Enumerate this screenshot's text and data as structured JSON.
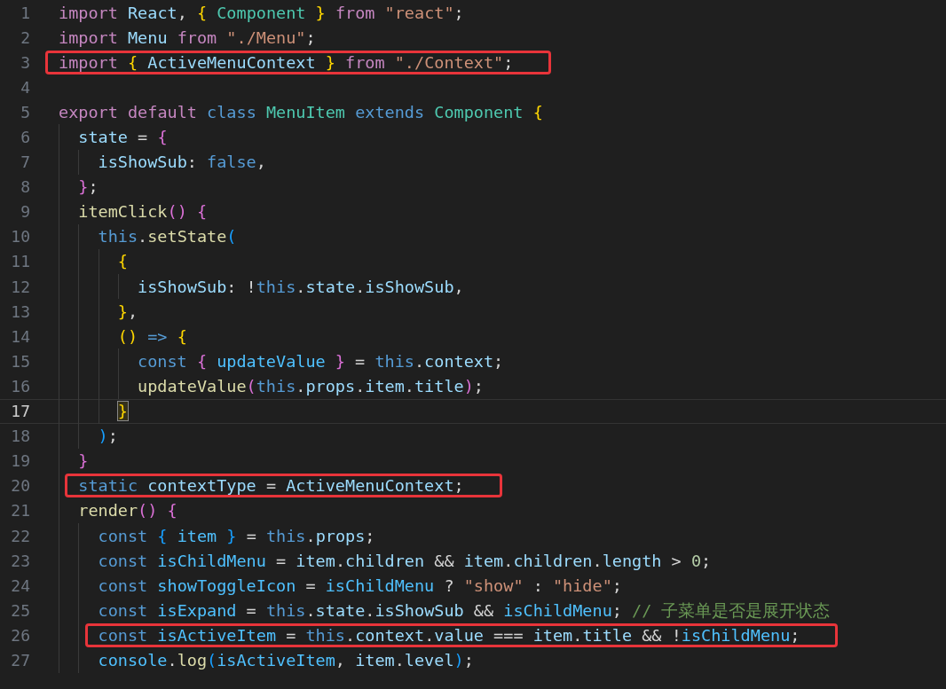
{
  "editor": {
    "lines": [
      {
        "number": "1",
        "current": false,
        "boxed": false,
        "tokens": [
          {
            "kind": "kw",
            "text": "import"
          },
          {
            "kind": "var",
            "text": " React"
          },
          {
            "kind": "p",
            "text": ", "
          },
          {
            "kind": "b1",
            "text": "{"
          },
          {
            "kind": "cls",
            "text": " Component"
          },
          {
            "kind": "b1",
            "text": " }"
          },
          {
            "kind": "kw",
            "text": " from"
          },
          {
            "kind": "str",
            "text": " \"react\""
          },
          {
            "kind": "p",
            "text": ";"
          }
        ]
      },
      {
        "number": "2",
        "current": false,
        "boxed": false,
        "tokens": [
          {
            "kind": "kw",
            "text": "import"
          },
          {
            "kind": "var",
            "text": " Menu"
          },
          {
            "kind": "kw",
            "text": " from"
          },
          {
            "kind": "str",
            "text": " \"./Menu\""
          },
          {
            "kind": "p",
            "text": ";"
          }
        ]
      },
      {
        "number": "3",
        "current": false,
        "boxed": true,
        "tokens": [
          {
            "kind": "kw",
            "text": "import"
          },
          {
            "kind": "b1",
            "text": " {"
          },
          {
            "kind": "var",
            "text": " ActiveMenuContext"
          },
          {
            "kind": "b1",
            "text": " }"
          },
          {
            "kind": "kw",
            "text": " from"
          },
          {
            "kind": "str",
            "text": " \"./Context\""
          },
          {
            "kind": "p",
            "text": ";"
          }
        ]
      },
      {
        "number": "4",
        "current": false
      },
      {
        "number": "5",
        "current": false,
        "boxed": false,
        "tokens": [
          {
            "kind": "kw",
            "text": "export"
          },
          {
            "kind": "kw",
            "text": " default"
          },
          {
            "kind": "decl",
            "text": " class"
          },
          {
            "kind": "cls",
            "text": " MenuItem"
          },
          {
            "kind": "decl",
            "text": " extends"
          },
          {
            "kind": "cls",
            "text": " Component"
          },
          {
            "kind": "b1",
            "text": " {"
          }
        ]
      },
      {
        "number": "6",
        "current": false,
        "boxed": false,
        "tokens": [
          {
            "kind": "var",
            "text": "  state"
          },
          {
            "kind": "p",
            "text": " = "
          },
          {
            "kind": "b2",
            "text": "{"
          }
        ]
      },
      {
        "number": "7",
        "current": false,
        "boxed": false,
        "tokens": [
          {
            "kind": "var",
            "text": "    isShowSub"
          },
          {
            "kind": "p",
            "text": ": "
          },
          {
            "kind": "decl",
            "text": "false"
          },
          {
            "kind": "p",
            "text": ","
          }
        ]
      },
      {
        "number": "8",
        "current": false,
        "boxed": false,
        "tokens": [
          {
            "kind": "b2",
            "text": "  }"
          },
          {
            "kind": "p",
            "text": ";"
          }
        ]
      },
      {
        "number": "9",
        "current": false,
        "boxed": false,
        "tokens": [
          {
            "kind": "fn",
            "text": "  itemClick"
          },
          {
            "kind": "b2",
            "text": "()"
          },
          {
            "kind": "b2",
            "text": " {"
          }
        ]
      },
      {
        "number": "10",
        "current": false,
        "boxed": false,
        "tokens": [
          {
            "kind": "decl",
            "text": "    this"
          },
          {
            "kind": "p",
            "text": "."
          },
          {
            "kind": "fn",
            "text": "setState"
          },
          {
            "kind": "b3",
            "text": "("
          }
        ]
      },
      {
        "number": "11",
        "current": false,
        "boxed": false,
        "tokens": [
          {
            "kind": "b1",
            "text": "      {"
          }
        ]
      },
      {
        "number": "12",
        "current": false,
        "boxed": false,
        "tokens": [
          {
            "kind": "var",
            "text": "        isShowSub"
          },
          {
            "kind": "p",
            "text": ": !"
          },
          {
            "kind": "decl",
            "text": "this"
          },
          {
            "kind": "p",
            "text": "."
          },
          {
            "kind": "var",
            "text": "state"
          },
          {
            "kind": "p",
            "text": "."
          },
          {
            "kind": "var",
            "text": "isShowSub"
          },
          {
            "kind": "p",
            "text": ","
          }
        ]
      },
      {
        "number": "13",
        "current": false,
        "boxed": false,
        "tokens": [
          {
            "kind": "b1",
            "text": "      }"
          },
          {
            "kind": "p",
            "text": ","
          }
        ]
      },
      {
        "number": "14",
        "current": false,
        "boxed": false,
        "tokens": [
          {
            "kind": "b1",
            "text": "      ()"
          },
          {
            "kind": "decl",
            "text": " =>"
          },
          {
            "kind": "b1",
            "text": " {"
          }
        ]
      },
      {
        "number": "15",
        "current": false,
        "boxed": false,
        "tokens": [
          {
            "kind": "decl",
            "text": "        const"
          },
          {
            "kind": "b2",
            "text": " {"
          },
          {
            "kind": "cst",
            "text": " updateValue"
          },
          {
            "kind": "b2",
            "text": " }"
          },
          {
            "kind": "p",
            "text": " = "
          },
          {
            "kind": "decl",
            "text": "this"
          },
          {
            "kind": "p",
            "text": "."
          },
          {
            "kind": "var",
            "text": "context"
          },
          {
            "kind": "p",
            "text": ";"
          }
        ]
      },
      {
        "number": "16",
        "current": false,
        "boxed": false,
        "tokens": [
          {
            "kind": "fn",
            "text": "        updateValue"
          },
          {
            "kind": "b2",
            "text": "("
          },
          {
            "kind": "decl",
            "text": "this"
          },
          {
            "kind": "p",
            "text": "."
          },
          {
            "kind": "var",
            "text": "props"
          },
          {
            "kind": "p",
            "text": "."
          },
          {
            "kind": "var",
            "text": "item"
          },
          {
            "kind": "p",
            "text": "."
          },
          {
            "kind": "var",
            "text": "title"
          },
          {
            "kind": "b2",
            "text": ")"
          },
          {
            "kind": "p",
            "text": ";"
          }
        ]
      },
      {
        "number": "17",
        "current": true,
        "boxed": false,
        "tokens": [
          {
            "kind": "b1match",
            "text": "      }"
          }
        ]
      },
      {
        "number": "18",
        "current": false,
        "boxed": false,
        "tokens": [
          {
            "kind": "b3",
            "text": "    )"
          },
          {
            "kind": "p",
            "text": ";"
          }
        ]
      },
      {
        "number": "19",
        "current": false,
        "boxed": false,
        "tokens": [
          {
            "kind": "b2",
            "text": "  }"
          }
        ]
      },
      {
        "number": "20",
        "current": false,
        "boxed": true,
        "tokens": [
          {
            "kind": "decl",
            "text": "  static"
          },
          {
            "kind": "var",
            "text": " contextType"
          },
          {
            "kind": "p",
            "text": " = "
          },
          {
            "kind": "var",
            "text": "ActiveMenuContext"
          },
          {
            "kind": "p",
            "text": ";"
          }
        ]
      },
      {
        "number": "21",
        "current": false,
        "boxed": false,
        "tokens": [
          {
            "kind": "fn",
            "text": "  render"
          },
          {
            "kind": "b2",
            "text": "()"
          },
          {
            "kind": "b2",
            "text": " {"
          }
        ]
      },
      {
        "number": "22",
        "current": false,
        "boxed": false,
        "tokens": [
          {
            "kind": "decl",
            "text": "    const"
          },
          {
            "kind": "b3",
            "text": " {"
          },
          {
            "kind": "cst",
            "text": " item"
          },
          {
            "kind": "b3",
            "text": " }"
          },
          {
            "kind": "p",
            "text": " = "
          },
          {
            "kind": "decl",
            "text": "this"
          },
          {
            "kind": "p",
            "text": "."
          },
          {
            "kind": "var",
            "text": "props"
          },
          {
            "kind": "p",
            "text": ";"
          }
        ]
      },
      {
        "number": "23",
        "current": false,
        "boxed": false,
        "tokens": [
          {
            "kind": "decl",
            "text": "    const"
          },
          {
            "kind": "cst",
            "text": " isChildMenu"
          },
          {
            "kind": "p",
            "text": " = "
          },
          {
            "kind": "var",
            "text": "item"
          },
          {
            "kind": "p",
            "text": "."
          },
          {
            "kind": "var",
            "text": "children"
          },
          {
            "kind": "p",
            "text": " && "
          },
          {
            "kind": "var",
            "text": "item"
          },
          {
            "kind": "p",
            "text": "."
          },
          {
            "kind": "var",
            "text": "children"
          },
          {
            "kind": "p",
            "text": "."
          },
          {
            "kind": "var",
            "text": "length"
          },
          {
            "kind": "p",
            "text": " > "
          },
          {
            "kind": "num",
            "text": "0"
          },
          {
            "kind": "p",
            "text": ";"
          }
        ]
      },
      {
        "number": "24",
        "current": false,
        "boxed": false,
        "tokens": [
          {
            "kind": "decl",
            "text": "    const"
          },
          {
            "kind": "cst",
            "text": " showToggleIcon"
          },
          {
            "kind": "p",
            "text": " = "
          },
          {
            "kind": "cst",
            "text": "isChildMenu"
          },
          {
            "kind": "p",
            "text": " ? "
          },
          {
            "kind": "str",
            "text": "\"show\""
          },
          {
            "kind": "p",
            "text": " : "
          },
          {
            "kind": "str",
            "text": "\"hide\""
          },
          {
            "kind": "p",
            "text": ";"
          }
        ]
      },
      {
        "number": "25",
        "current": false,
        "boxed": false,
        "tokens": [
          {
            "kind": "decl",
            "text": "    const"
          },
          {
            "kind": "cst",
            "text": " isExpand"
          },
          {
            "kind": "p",
            "text": " = "
          },
          {
            "kind": "decl",
            "text": "this"
          },
          {
            "kind": "p",
            "text": "."
          },
          {
            "kind": "var",
            "text": "state"
          },
          {
            "kind": "p",
            "text": "."
          },
          {
            "kind": "var",
            "text": "isShowSub"
          },
          {
            "kind": "p",
            "text": " && "
          },
          {
            "kind": "cst",
            "text": "isChildMenu"
          },
          {
            "kind": "p",
            "text": "; "
          },
          {
            "kind": "cmt",
            "text": "// 子菜单是否是展开状态"
          }
        ]
      },
      {
        "number": "26",
        "current": false,
        "boxed": true,
        "tokens": [
          {
            "kind": "decl",
            "text": "    const"
          },
          {
            "kind": "cst",
            "text": " isActiveItem"
          },
          {
            "kind": "p",
            "text": " = "
          },
          {
            "kind": "decl",
            "text": "this"
          },
          {
            "kind": "p",
            "text": "."
          },
          {
            "kind": "var",
            "text": "context"
          },
          {
            "kind": "p",
            "text": "."
          },
          {
            "kind": "var",
            "text": "value"
          },
          {
            "kind": "p",
            "text": " === "
          },
          {
            "kind": "var",
            "text": "item"
          },
          {
            "kind": "p",
            "text": "."
          },
          {
            "kind": "var",
            "text": "title"
          },
          {
            "kind": "p",
            "text": " && !"
          },
          {
            "kind": "cst",
            "text": "isChildMenu"
          },
          {
            "kind": "p",
            "text": ";"
          }
        ]
      },
      {
        "number": "27",
        "current": false,
        "boxed": false,
        "tokens": [
          {
            "kind": "cst",
            "text": "    console"
          },
          {
            "kind": "p",
            "text": "."
          },
          {
            "kind": "fn",
            "text": "log"
          },
          {
            "kind": "b3",
            "text": "("
          },
          {
            "kind": "cst",
            "text": "isActiveItem"
          },
          {
            "kind": "p",
            "text": ", "
          },
          {
            "kind": "var",
            "text": "item"
          },
          {
            "kind": "p",
            "text": "."
          },
          {
            "kind": "var",
            "text": "level"
          },
          {
            "kind": "b3",
            "text": ")"
          },
          {
            "kind": "p",
            "text": ";"
          }
        ]
      }
    ]
  }
}
